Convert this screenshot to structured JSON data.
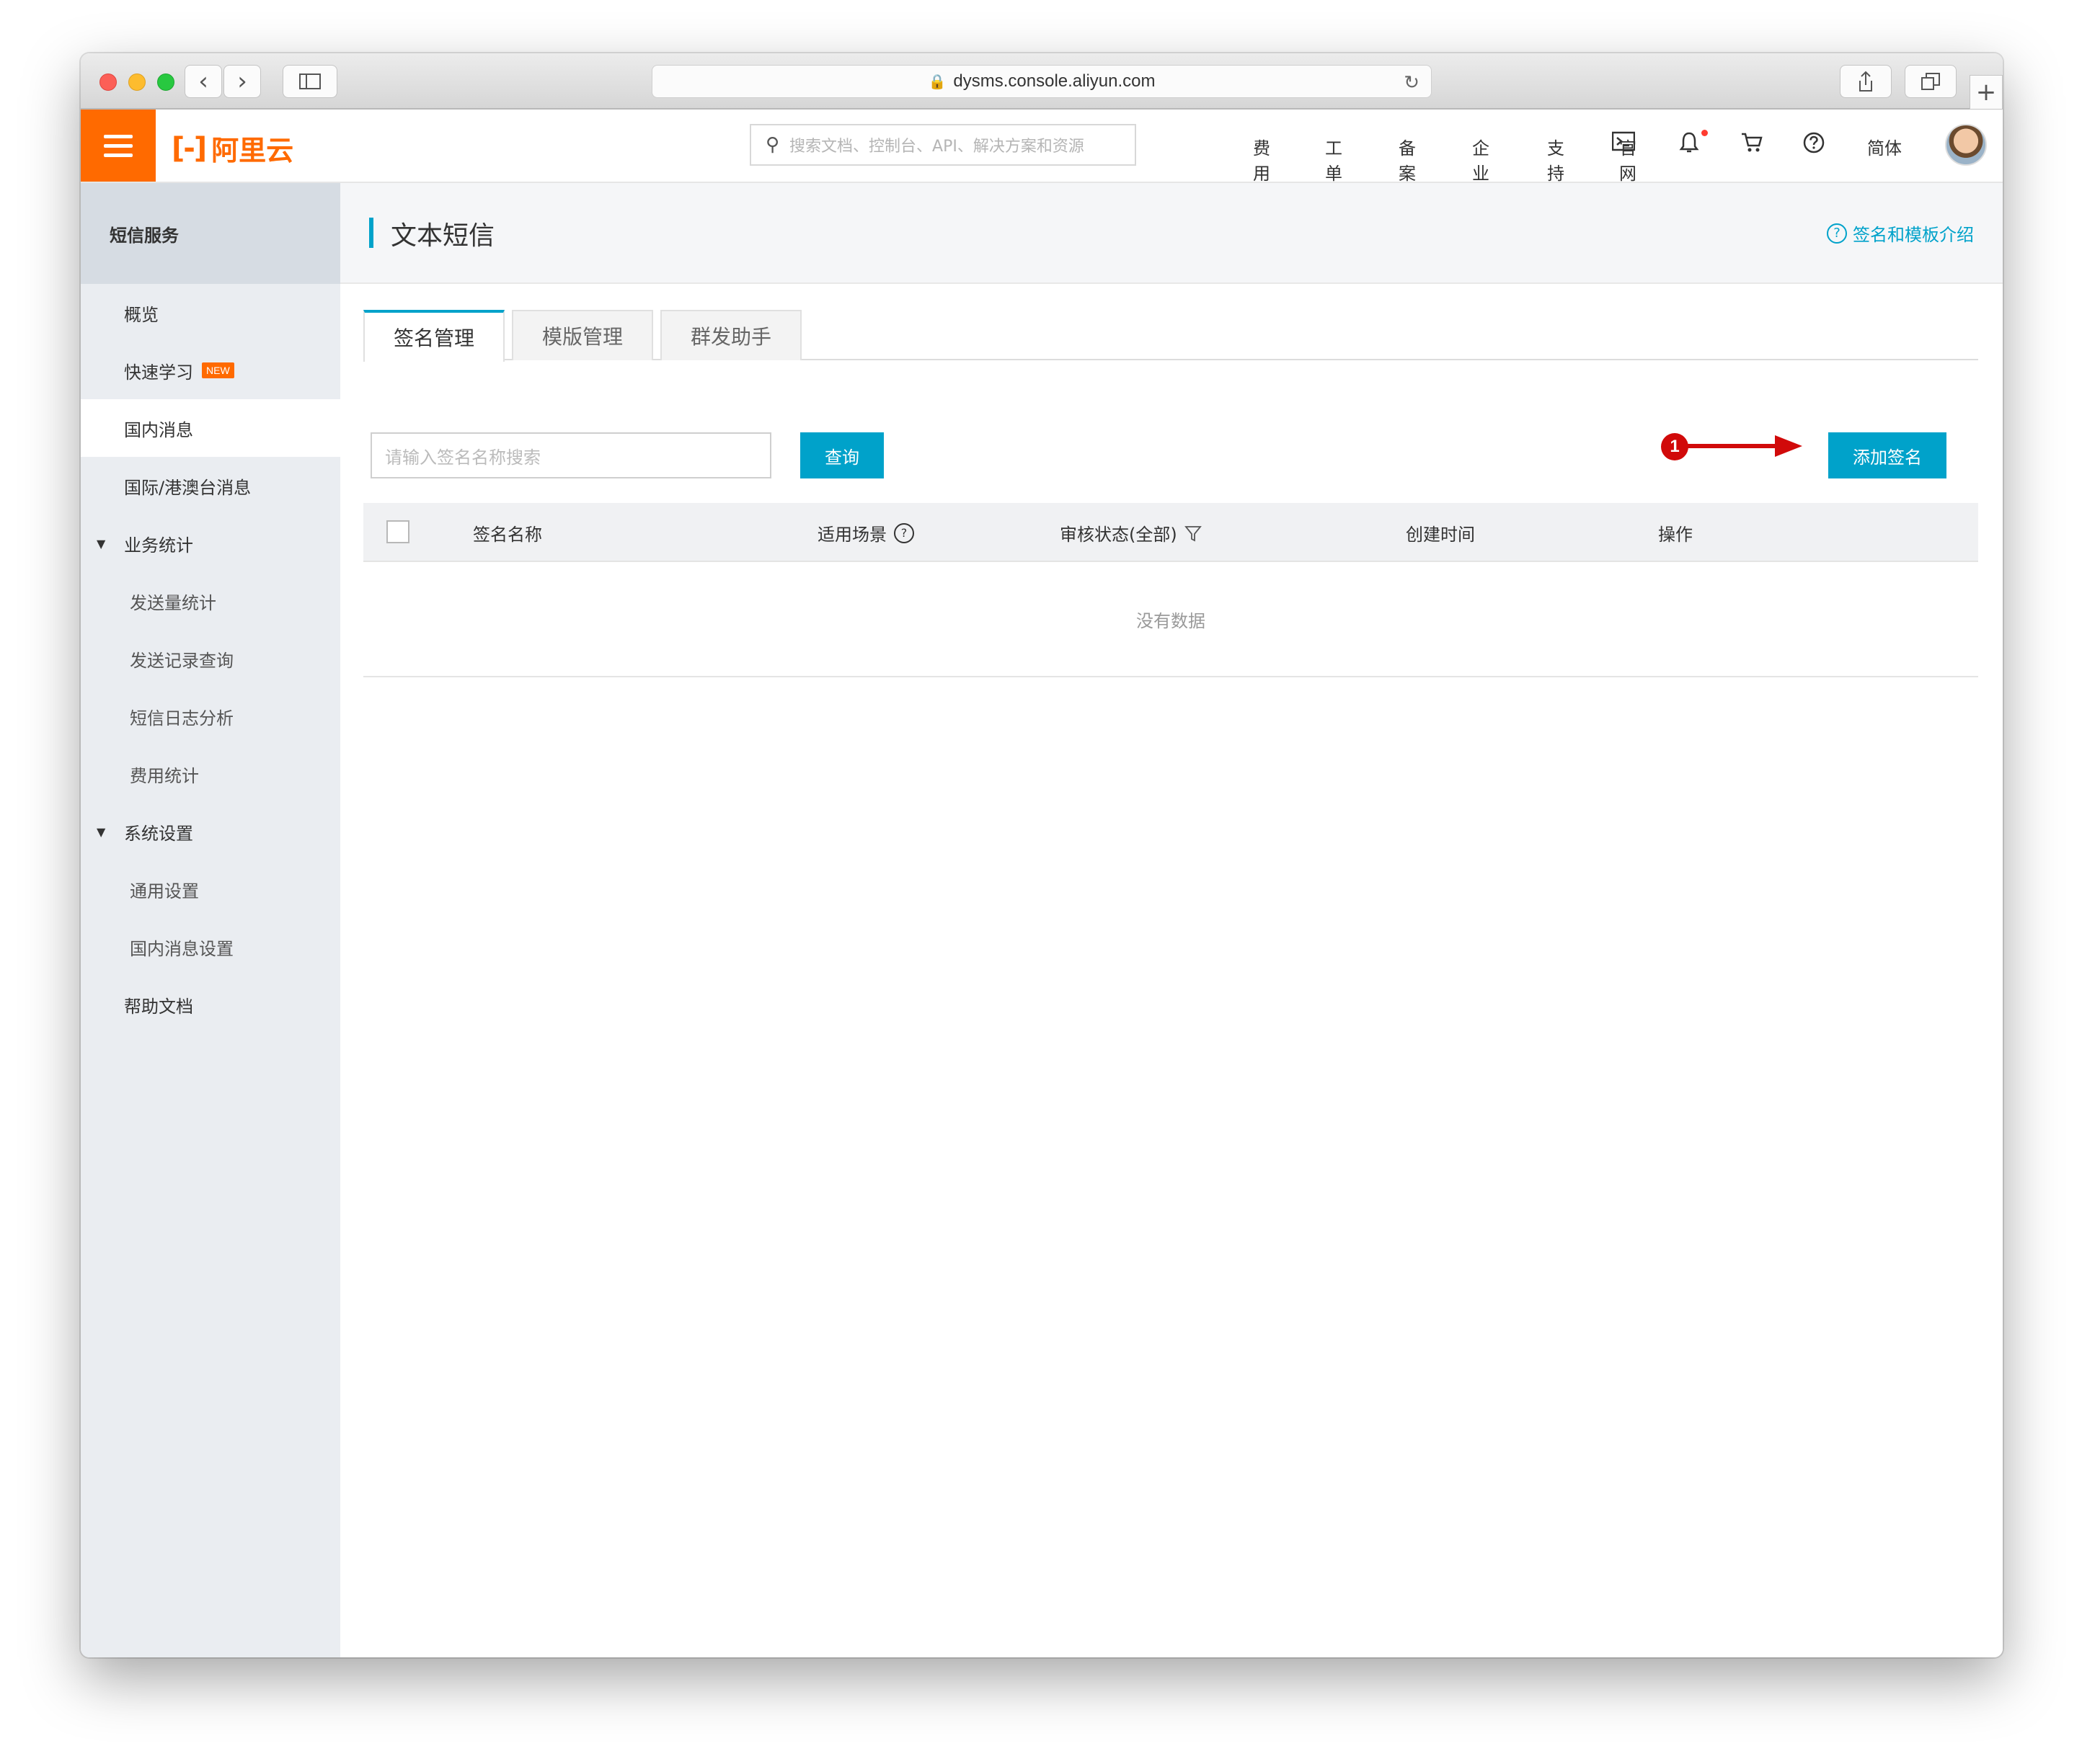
{
  "browser": {
    "url": "dysms.console.aliyun.com",
    "buttons": {
      "back": "‹",
      "forward": "›"
    }
  },
  "topnav": {
    "logo_mark": "[-]",
    "logo_text": "阿里云",
    "search_placeholder": "搜索文档、控制台、API、解决方案和资源",
    "links": [
      "费用",
      "工单",
      "备案",
      "企业",
      "支持",
      "官网"
    ],
    "language": "简体"
  },
  "sidebar": {
    "header": "短信服务",
    "items": [
      {
        "label": "概览"
      },
      {
        "label": "快速学习",
        "badge": "NEW"
      },
      {
        "label": "国内消息"
      },
      {
        "label": "国际/港澳台消息"
      },
      {
        "label": "业务统计"
      },
      {
        "label": "发送量统计"
      },
      {
        "label": "发送记录查询"
      },
      {
        "label": "短信日志分析"
      },
      {
        "label": "费用统计"
      },
      {
        "label": "系统设置"
      },
      {
        "label": "通用设置"
      },
      {
        "label": "国内消息设置"
      },
      {
        "label": "帮助文档"
      }
    ]
  },
  "main": {
    "title": "文本短信",
    "help_link": "签名和模板介绍",
    "tabs": [
      "签名管理",
      "模版管理",
      "群发助手"
    ],
    "search_placeholder": "请输入签名名称搜索",
    "query_button": "查询",
    "add_button": "添加签名",
    "annotation_number": "1",
    "table": {
      "columns": [
        "签名名称",
        "适用场景",
        "审核状态(全部)",
        "创建时间",
        "操作"
      ],
      "empty_text": "没有数据"
    }
  },
  "colors": {
    "brand": "#ff6a00",
    "accent": "#00a2ca",
    "annotation": "#d10a0a"
  }
}
